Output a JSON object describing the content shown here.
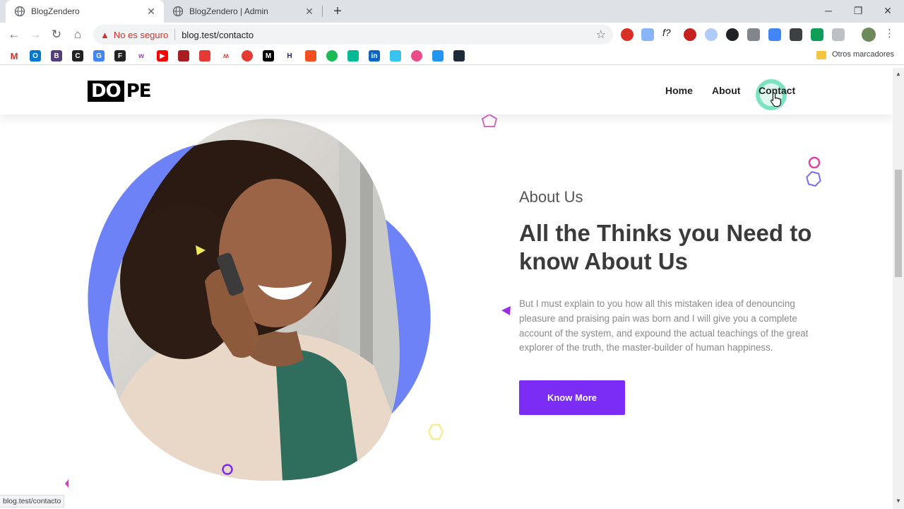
{
  "browser": {
    "tabs": [
      {
        "title": "BlogZendero",
        "active": true
      },
      {
        "title": "BlogZendero | Admin",
        "active": false
      }
    ],
    "address": {
      "security_label": "No es seguro",
      "url": "blog.test/contacto"
    },
    "bookmarks_other": "Otros marcadores",
    "status_url": "blog.test/contacto",
    "colors": {
      "tabstrip": "#dee1e6",
      "warning": "#d93025"
    }
  },
  "site": {
    "logo": {
      "boxed": "DO",
      "rest": "PE"
    },
    "nav": [
      "Home",
      "About",
      "Contact"
    ],
    "about": {
      "subtitle": "About Us",
      "title": "All the Thinks you Need to know About Us",
      "text": " But I must explain to you how all this mistaken idea of denouncing pleasure and praising pain was born and I will give you a complete account of the system, and expound the actual teachings of the great explorer of the truth, the master-builder of human happiness.",
      "button": "Know More"
    },
    "colors": {
      "accent": "#7b2cf5",
      "blob": "#6e82f7",
      "ring": "#7ce3c0"
    }
  }
}
